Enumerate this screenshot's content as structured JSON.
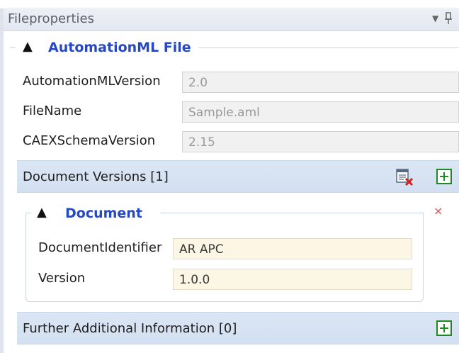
{
  "panel": {
    "title": "Fileproperties"
  },
  "automationml_group": {
    "title": "AutomationML File",
    "properties": [
      {
        "label": "AutomationMLVersion",
        "value": "2.0"
      },
      {
        "label": "FileName",
        "value": "Sample.aml"
      },
      {
        "label": "CAEXSchemaVersion",
        "value": "2.15"
      }
    ]
  },
  "document_versions": {
    "label": "Document Versions [1]"
  },
  "document_group": {
    "title": "Document",
    "delete_glyph": "×",
    "properties": [
      {
        "label": "DocumentIdentifier",
        "value": "AR APC"
      },
      {
        "label": "Version",
        "value": "1.0.0"
      }
    ]
  },
  "further_info": {
    "label": "Further Additional Information [0]"
  },
  "colors": {
    "group_title": "#2548c7",
    "add_button": "#1f8a1f",
    "delete": "#e05050",
    "section_bar": "#d7e3f2"
  },
  "icons": {
    "dropdown": "chevron-down-icon",
    "pin": "pin-icon",
    "collapse": "triangle-up-icon",
    "delete_list": "delete-list-icon",
    "add": "add-icon"
  }
}
